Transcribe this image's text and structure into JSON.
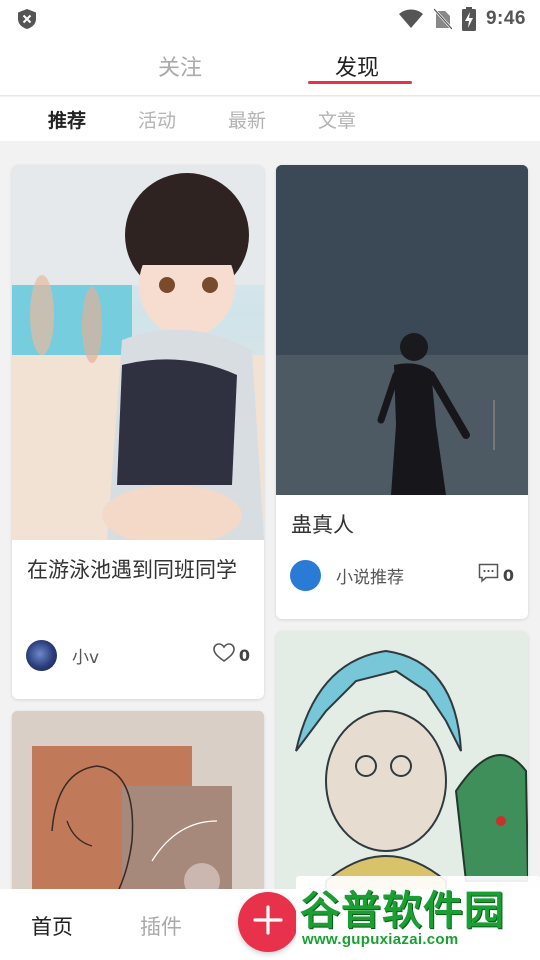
{
  "status_bar": {
    "time": "9:46",
    "icons": [
      "shield-icon",
      "wifi-icon",
      "no-sim-icon",
      "battery-charging-icon"
    ]
  },
  "top_tabs": [
    {
      "label": "关注",
      "active": false
    },
    {
      "label": "发现",
      "active": true
    }
  ],
  "sub_tabs": [
    {
      "label": "推荐",
      "active": true
    },
    {
      "label": "活动",
      "active": false
    },
    {
      "label": "最新",
      "active": false
    },
    {
      "label": "文章",
      "active": false
    }
  ],
  "feed": [
    {
      "title": "在游泳池遇到同班同学",
      "author": "小v",
      "count": "0",
      "count_icon": "heart-icon"
    },
    {
      "title": "蛊真人",
      "author": "小说推荐",
      "count": "0",
      "count_icon": "comment-icon"
    }
  ],
  "bottom_nav": {
    "home_label": "首页",
    "plugin_label": "插件",
    "fab_icon": "plus-icon"
  },
  "watermark": {
    "main": "谷普软件园",
    "sub": "www.gupuxiazai.com"
  },
  "colors": {
    "accent": "#e8314a",
    "watermark_green": "#1aa032"
  }
}
